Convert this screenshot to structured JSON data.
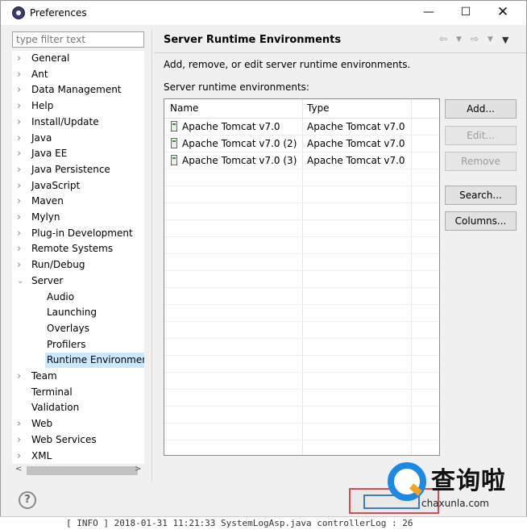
{
  "window": {
    "title": "Preferences",
    "min": "—",
    "max": "☐",
    "close": "✕"
  },
  "filter": {
    "placeholder": "type filter text"
  },
  "tree": {
    "items": [
      {
        "label": "General",
        "expandable": true
      },
      {
        "label": "Ant",
        "expandable": true
      },
      {
        "label": "Data Management",
        "expandable": true
      },
      {
        "label": "Help",
        "expandable": true
      },
      {
        "label": "Install/Update",
        "expandable": true
      },
      {
        "label": "Java",
        "expandable": true
      },
      {
        "label": "Java EE",
        "expandable": true
      },
      {
        "label": "Java Persistence",
        "expandable": true
      },
      {
        "label": "JavaScript",
        "expandable": true
      },
      {
        "label": "Maven",
        "expandable": true
      },
      {
        "label": "Mylyn",
        "expandable": true
      },
      {
        "label": "Plug-in Development",
        "expandable": true
      },
      {
        "label": "Remote Systems",
        "expandable": true
      },
      {
        "label": "Run/Debug",
        "expandable": true
      },
      {
        "label": "Server",
        "expandable": true,
        "expanded": true
      },
      {
        "label": "Audio",
        "child": true
      },
      {
        "label": "Launching",
        "child": true
      },
      {
        "label": "Overlays",
        "child": true
      },
      {
        "label": "Profilers",
        "child": true
      },
      {
        "label": "Runtime Environment",
        "child": true,
        "selected": true
      },
      {
        "label": "Team",
        "expandable": true
      },
      {
        "label": "Terminal",
        "expandable": false
      },
      {
        "label": "Validation",
        "expandable": false
      },
      {
        "label": "Web",
        "expandable": true
      },
      {
        "label": "Web Services",
        "expandable": true
      },
      {
        "label": "XML",
        "expandable": true
      }
    ]
  },
  "page": {
    "title": "Server Runtime Environments",
    "description": "Add, remove, or edit server runtime environments.",
    "list_label": "Server runtime environments:",
    "table": {
      "columns": [
        "Name",
        "Type"
      ],
      "rows": [
        {
          "name": "Apache Tomcat v7.0",
          "type": "Apache Tomcat v7.0"
        },
        {
          "name": "Apache Tomcat v7.0 (2)",
          "type": "Apache Tomcat v7.0"
        },
        {
          "name": "Apache Tomcat v7.0 (3)",
          "type": "Apache Tomcat v7.0"
        }
      ]
    },
    "buttons": {
      "add": "Add...",
      "edit": "Edit...",
      "remove": "Remove",
      "search": "Search...",
      "columns": "Columns..."
    }
  },
  "watermark": {
    "text": "查询啦",
    "url": "chaxunla.com"
  },
  "background_log": "[ INFO ] 2018-01-31 11:21:33 SystemLogAsp.java controllerLog : 26"
}
